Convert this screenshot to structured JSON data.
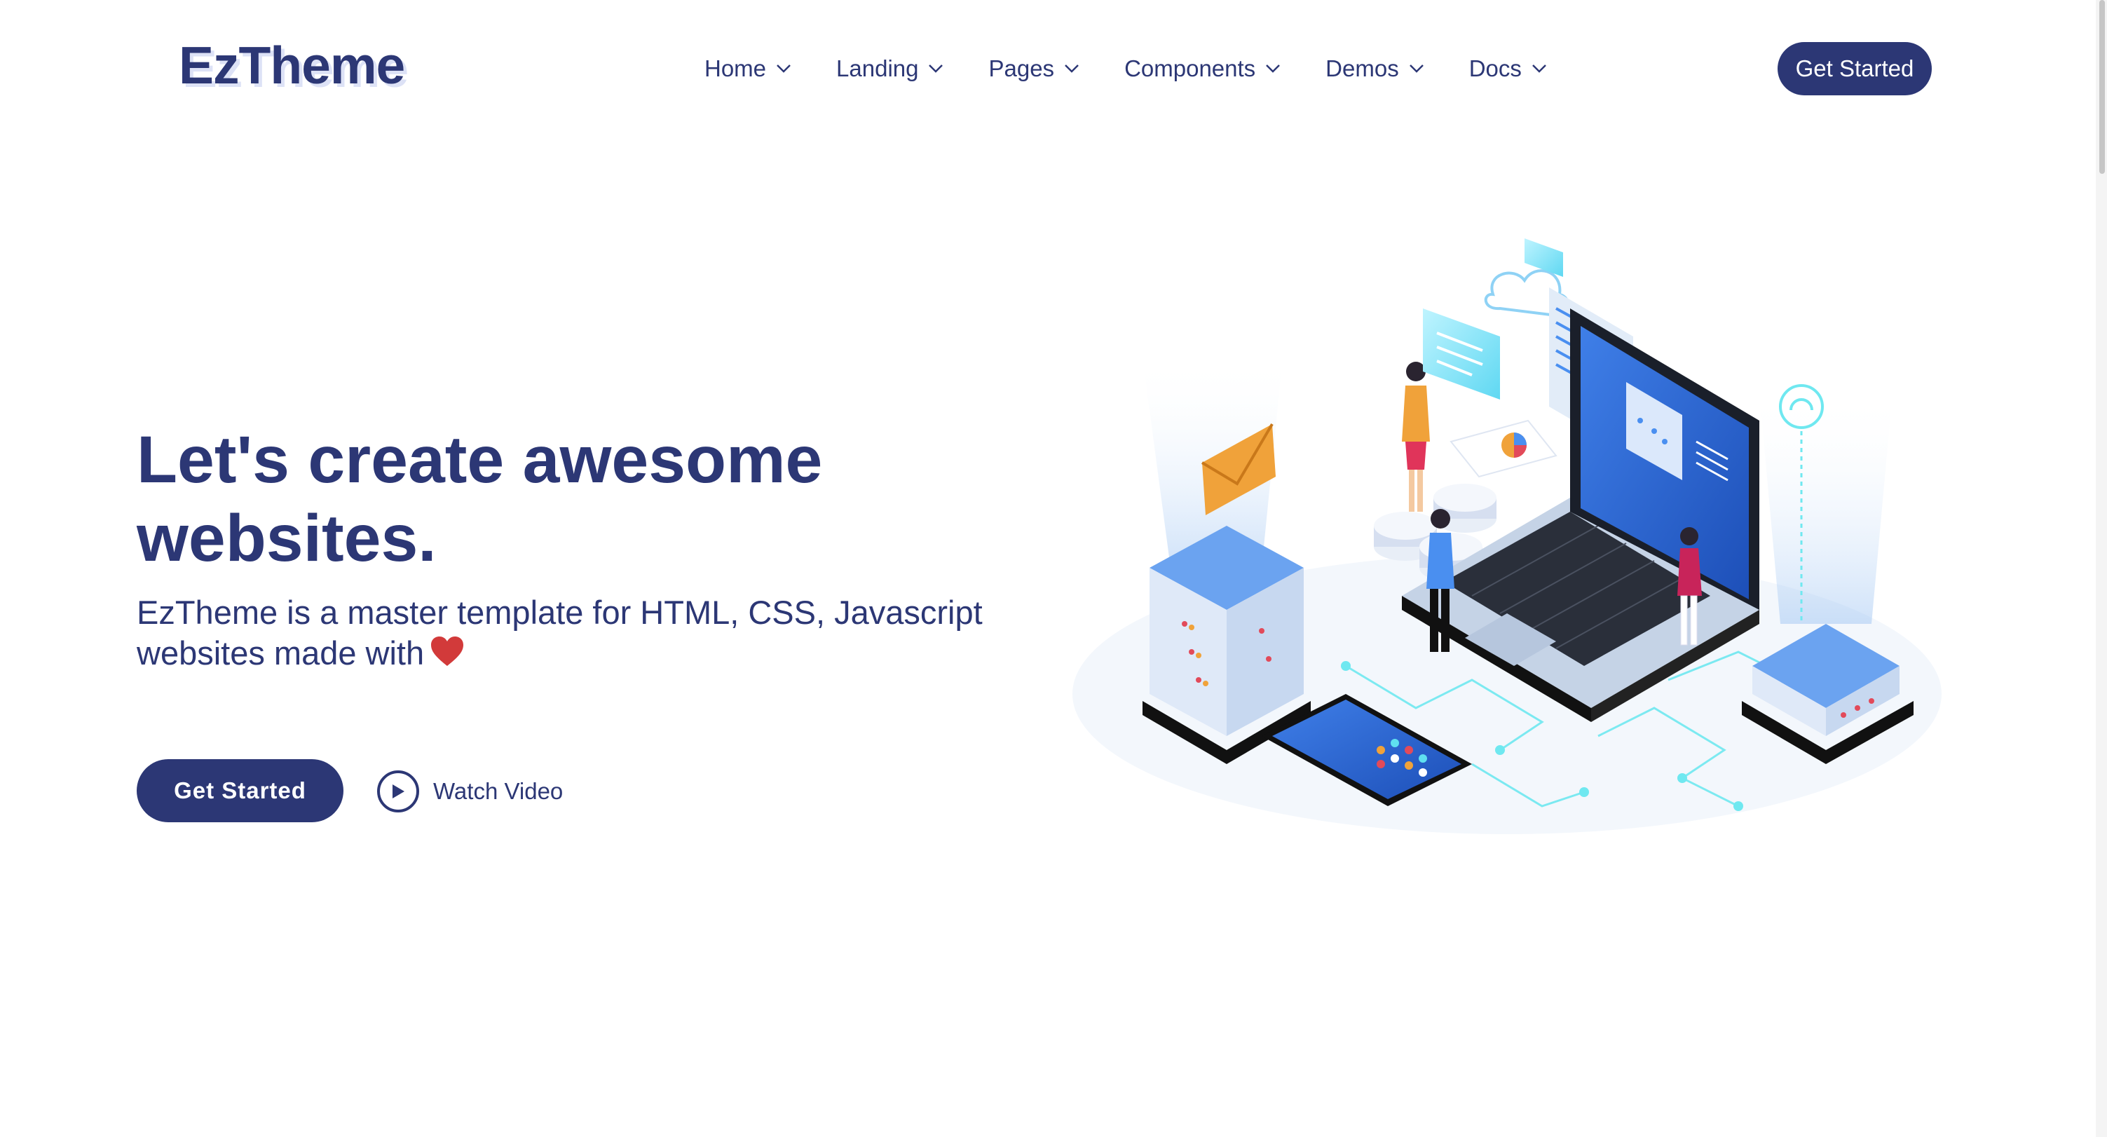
{
  "header": {
    "logo": "EzTheme",
    "nav": [
      {
        "label": "Home"
      },
      {
        "label": "Landing"
      },
      {
        "label": "Pages"
      },
      {
        "label": "Components"
      },
      {
        "label": "Demos"
      },
      {
        "label": "Docs"
      }
    ],
    "cta_label": "Get Started"
  },
  "hero": {
    "title": "Let's create awesome websites.",
    "subtitle": "EzTheme is a master template for HTML, CSS, Javascript websites made with",
    "subtitle_icon": "heart-icon",
    "cta_label": "Get Started",
    "watch_label": "Watch Video",
    "watch_icon": "play-icon",
    "illustration_icon": "isometric-tech-illustration"
  },
  "colors": {
    "primary": "#2c3775",
    "heart": "#d23a3a",
    "accent_blue": "#4a8ff0",
    "accent_cyan": "#5fe0f0",
    "accent_orange": "#f0a23a"
  }
}
